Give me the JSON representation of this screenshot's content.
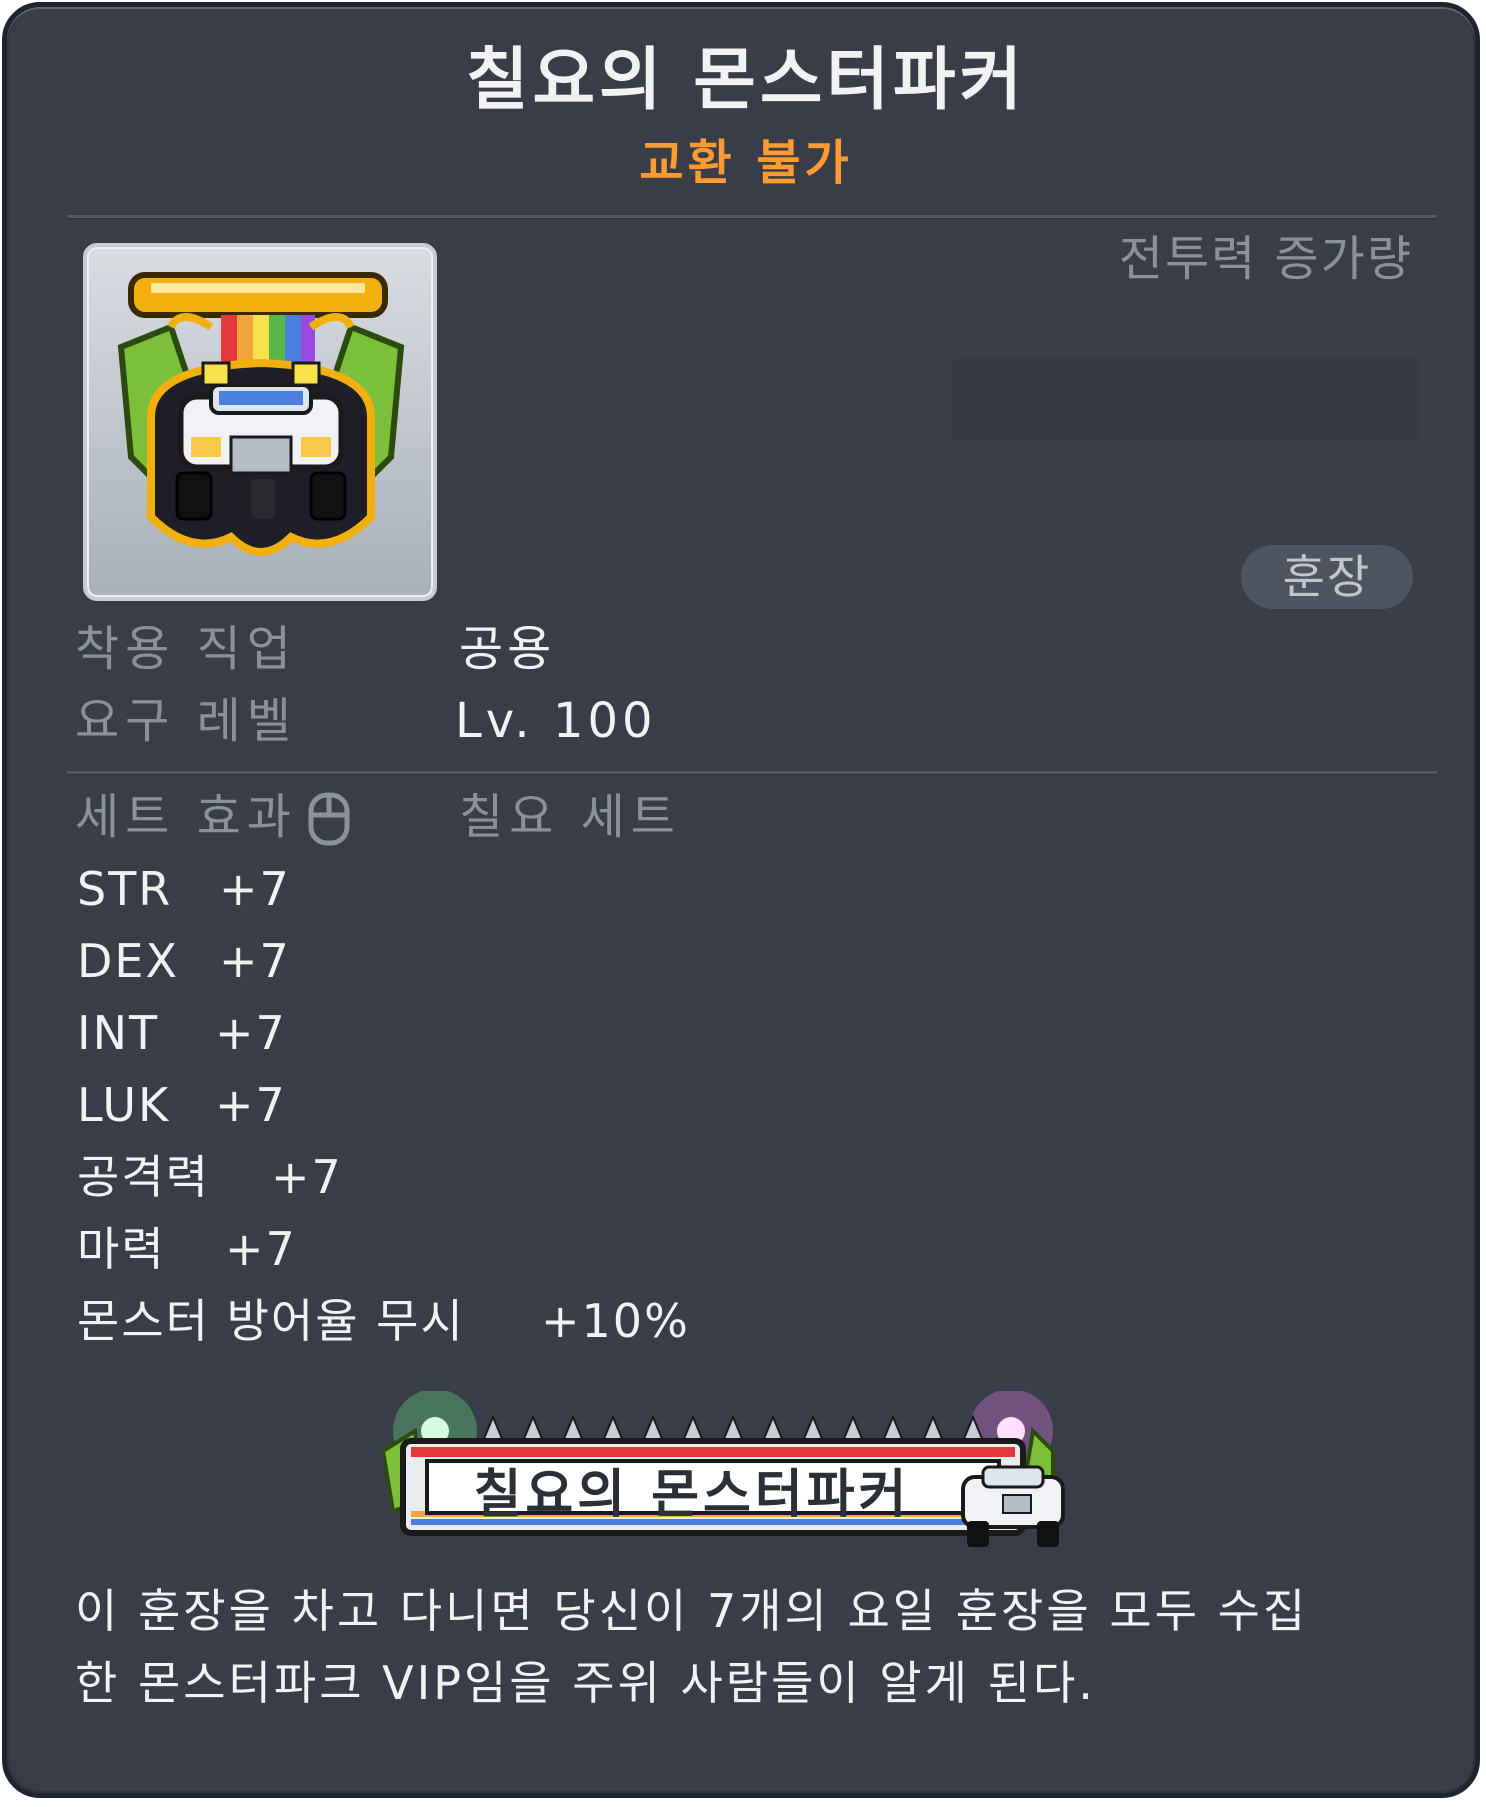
{
  "item": {
    "name": "칠요의 몬스터파커",
    "trade_status": "교환 불가",
    "trade_status_color": "#ff9b32",
    "icon": "monster-parker-medal-icon"
  },
  "combat": {
    "label": "전투력 증가량"
  },
  "badge": {
    "label": "훈장"
  },
  "requirements": {
    "job_label": "착용 직업",
    "job_value": "공용",
    "level_label": "요구 레벨",
    "level_value": "Lv. 100"
  },
  "set_effect": {
    "label": "세트 효과",
    "name": "칠요 세트",
    "stats": [
      {
        "name": "STR",
        "value": "+7"
      },
      {
        "name": "DEX",
        "value": "+7"
      },
      {
        "name": "INT",
        "value": "+7"
      },
      {
        "name": "LUK",
        "value": "+7"
      },
      {
        "name": "공격력",
        "value": "+7"
      },
      {
        "name": "마력",
        "value": "+7"
      },
      {
        "name": "몬스터 방어율 무시",
        "value": "+10%"
      }
    ]
  },
  "medal": {
    "text": "칠요의 몬스터파커"
  },
  "description": {
    "line1": "이 훈장을 차고 다니면 당신이 7개의 요일 훈장을 모두 수집",
    "line2": "한 몬스터파크 VIP임을 주위 사람들이 알게 된다."
  }
}
